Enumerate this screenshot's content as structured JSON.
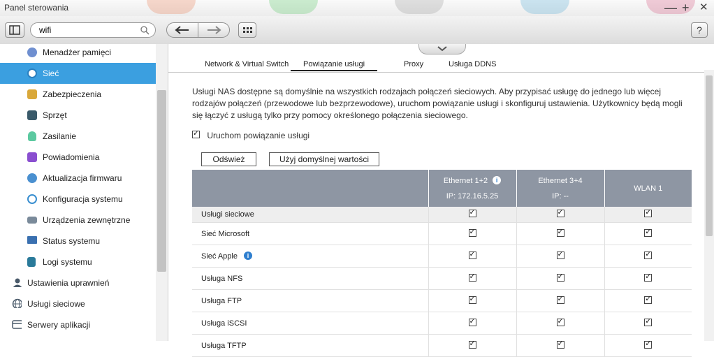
{
  "window": {
    "title": "Panel sterowania",
    "minimize": "—",
    "maximize": "+",
    "close": "✕"
  },
  "toolbar": {
    "search_value": "wifi",
    "help": "?"
  },
  "sidebar": {
    "items": [
      {
        "label": "Menadżer pamięci",
        "icon": "storage-icon",
        "color": "#6f8fd0"
      },
      {
        "label": "Sieć",
        "icon": "network-icon",
        "color": "#ffffff"
      },
      {
        "label": "Zabezpieczenia",
        "icon": "lock-icon",
        "color": "#d9a83a"
      },
      {
        "label": "Sprzęt",
        "icon": "hardware-icon",
        "color": "#3a5a6a"
      },
      {
        "label": "Zasilanie",
        "icon": "power-bulb-icon",
        "color": "#5cc9a0"
      },
      {
        "label": "Powiadomienia",
        "icon": "notification-icon",
        "color": "#8a4fd0"
      },
      {
        "label": "Aktualizacja firmwaru",
        "icon": "firmware-update-icon",
        "color": "#4a90d0"
      },
      {
        "label": "Konfiguracja systemu",
        "icon": "system-config-icon",
        "color": "#3a8fd0"
      },
      {
        "label": "Urządzenia zewnętrzne",
        "icon": "external-device-icon",
        "color": "#7a8a9a"
      },
      {
        "label": "Status systemu",
        "icon": "system-status-icon",
        "color": "#3a70b0"
      },
      {
        "label": "Logi systemu",
        "icon": "system-log-icon",
        "color": "#2a7a9a"
      }
    ],
    "groups": [
      {
        "label": "Ustawienia uprawnień",
        "icon": "user-permissions-icon"
      },
      {
        "label": "Usługi sieciowe",
        "icon": "network-services-icon"
      },
      {
        "label": "Serwery aplikacji",
        "icon": "app-servers-icon"
      }
    ]
  },
  "tabs": [
    "Network & Virtual Switch",
    "Powiązanie usługi",
    "Proxy",
    "Usługa DDNS"
  ],
  "main": {
    "description": "Usługi NAS dostępne są domyślnie na wszystkich rodzajach połączeń sieciowych. Aby przypisać usługę do jednego lub więcej rodzajów połączeń (przewodowe lub bezprzewodowe), uruchom powiązanie usługi i skonfiguruj ustawienia. Użytkownicy będą mogli się łączyć z usługą tylko przy pomocy określonego połączenia sieciowego.",
    "enable_label": "Uruchom powiązanie usługi",
    "refresh_button": "Odśwież",
    "default_button": "Użyj domyślnej wartości"
  },
  "table": {
    "columns": [
      {
        "name": "Ethernet 1+2",
        "ip": "IP: 172.16.5.25",
        "info": true
      },
      {
        "name": "Ethernet 3+4",
        "ip": "IP: --",
        "info": false
      },
      {
        "name": "WLAN 1",
        "ip": "",
        "info": false
      }
    ],
    "group_label": "Usługi sieciowe",
    "rows": [
      {
        "name": "Sieć Microsoft",
        "info": false
      },
      {
        "name": "Sieć Apple",
        "info": true
      },
      {
        "name": "Usługa NFS",
        "info": false
      },
      {
        "name": "Usługa FTP",
        "info": false
      },
      {
        "name": "Usługa iSCSI",
        "info": false
      },
      {
        "name": "Usługa TFTP",
        "info": false
      }
    ]
  }
}
